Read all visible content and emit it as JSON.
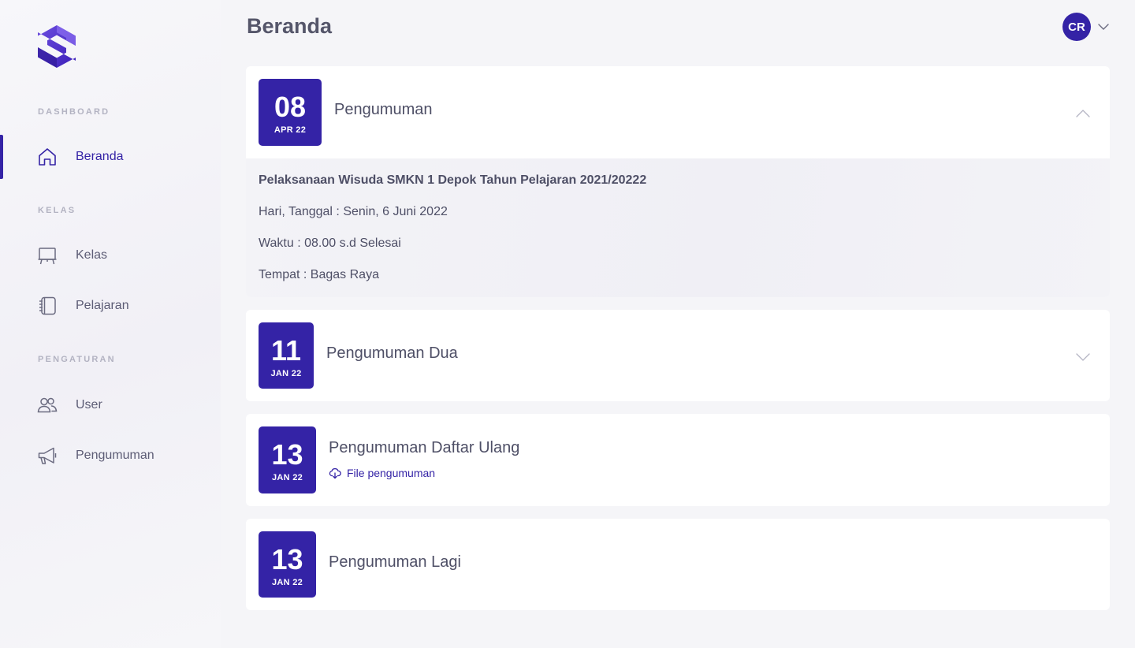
{
  "sidebar": {
    "sections": {
      "dashboard": "DASHBOARD",
      "kelas": "KELAS",
      "pengaturan": "PENGATURAN"
    },
    "items": {
      "beranda": "Beranda",
      "kelas": "Kelas",
      "pelajaran": "Pelajaran",
      "user": "User",
      "pengumuman": "Pengumuman"
    }
  },
  "header": {
    "title": "Beranda",
    "avatar_initials": "CR"
  },
  "announcements": [
    {
      "day": "08",
      "month": "APR 22",
      "title": "Pengumuman",
      "expanded": true,
      "body": [
        "Pelaksanaan Wisuda SMKN 1 Depok Tahun Pelajaran 2021/20222",
        "Hari, Tanggal : Senin, 6 Juni 2022",
        "Waktu : 08.00 s.d Selesai",
        "Tempat : Bagas Raya"
      ]
    },
    {
      "day": "11",
      "month": "JAN 22",
      "title": "Pengumuman Dua",
      "expanded": false
    },
    {
      "day": "13",
      "month": "JAN 22",
      "title": "Pengumuman Daftar Ulang",
      "file_link": "File pengumuman"
    },
    {
      "day": "13",
      "month": "JAN 22",
      "title": "Pengumuman Lagi"
    }
  ],
  "colors": {
    "primary": "#3423a6",
    "background": "#f5f5f8",
    "text": "#565670"
  }
}
